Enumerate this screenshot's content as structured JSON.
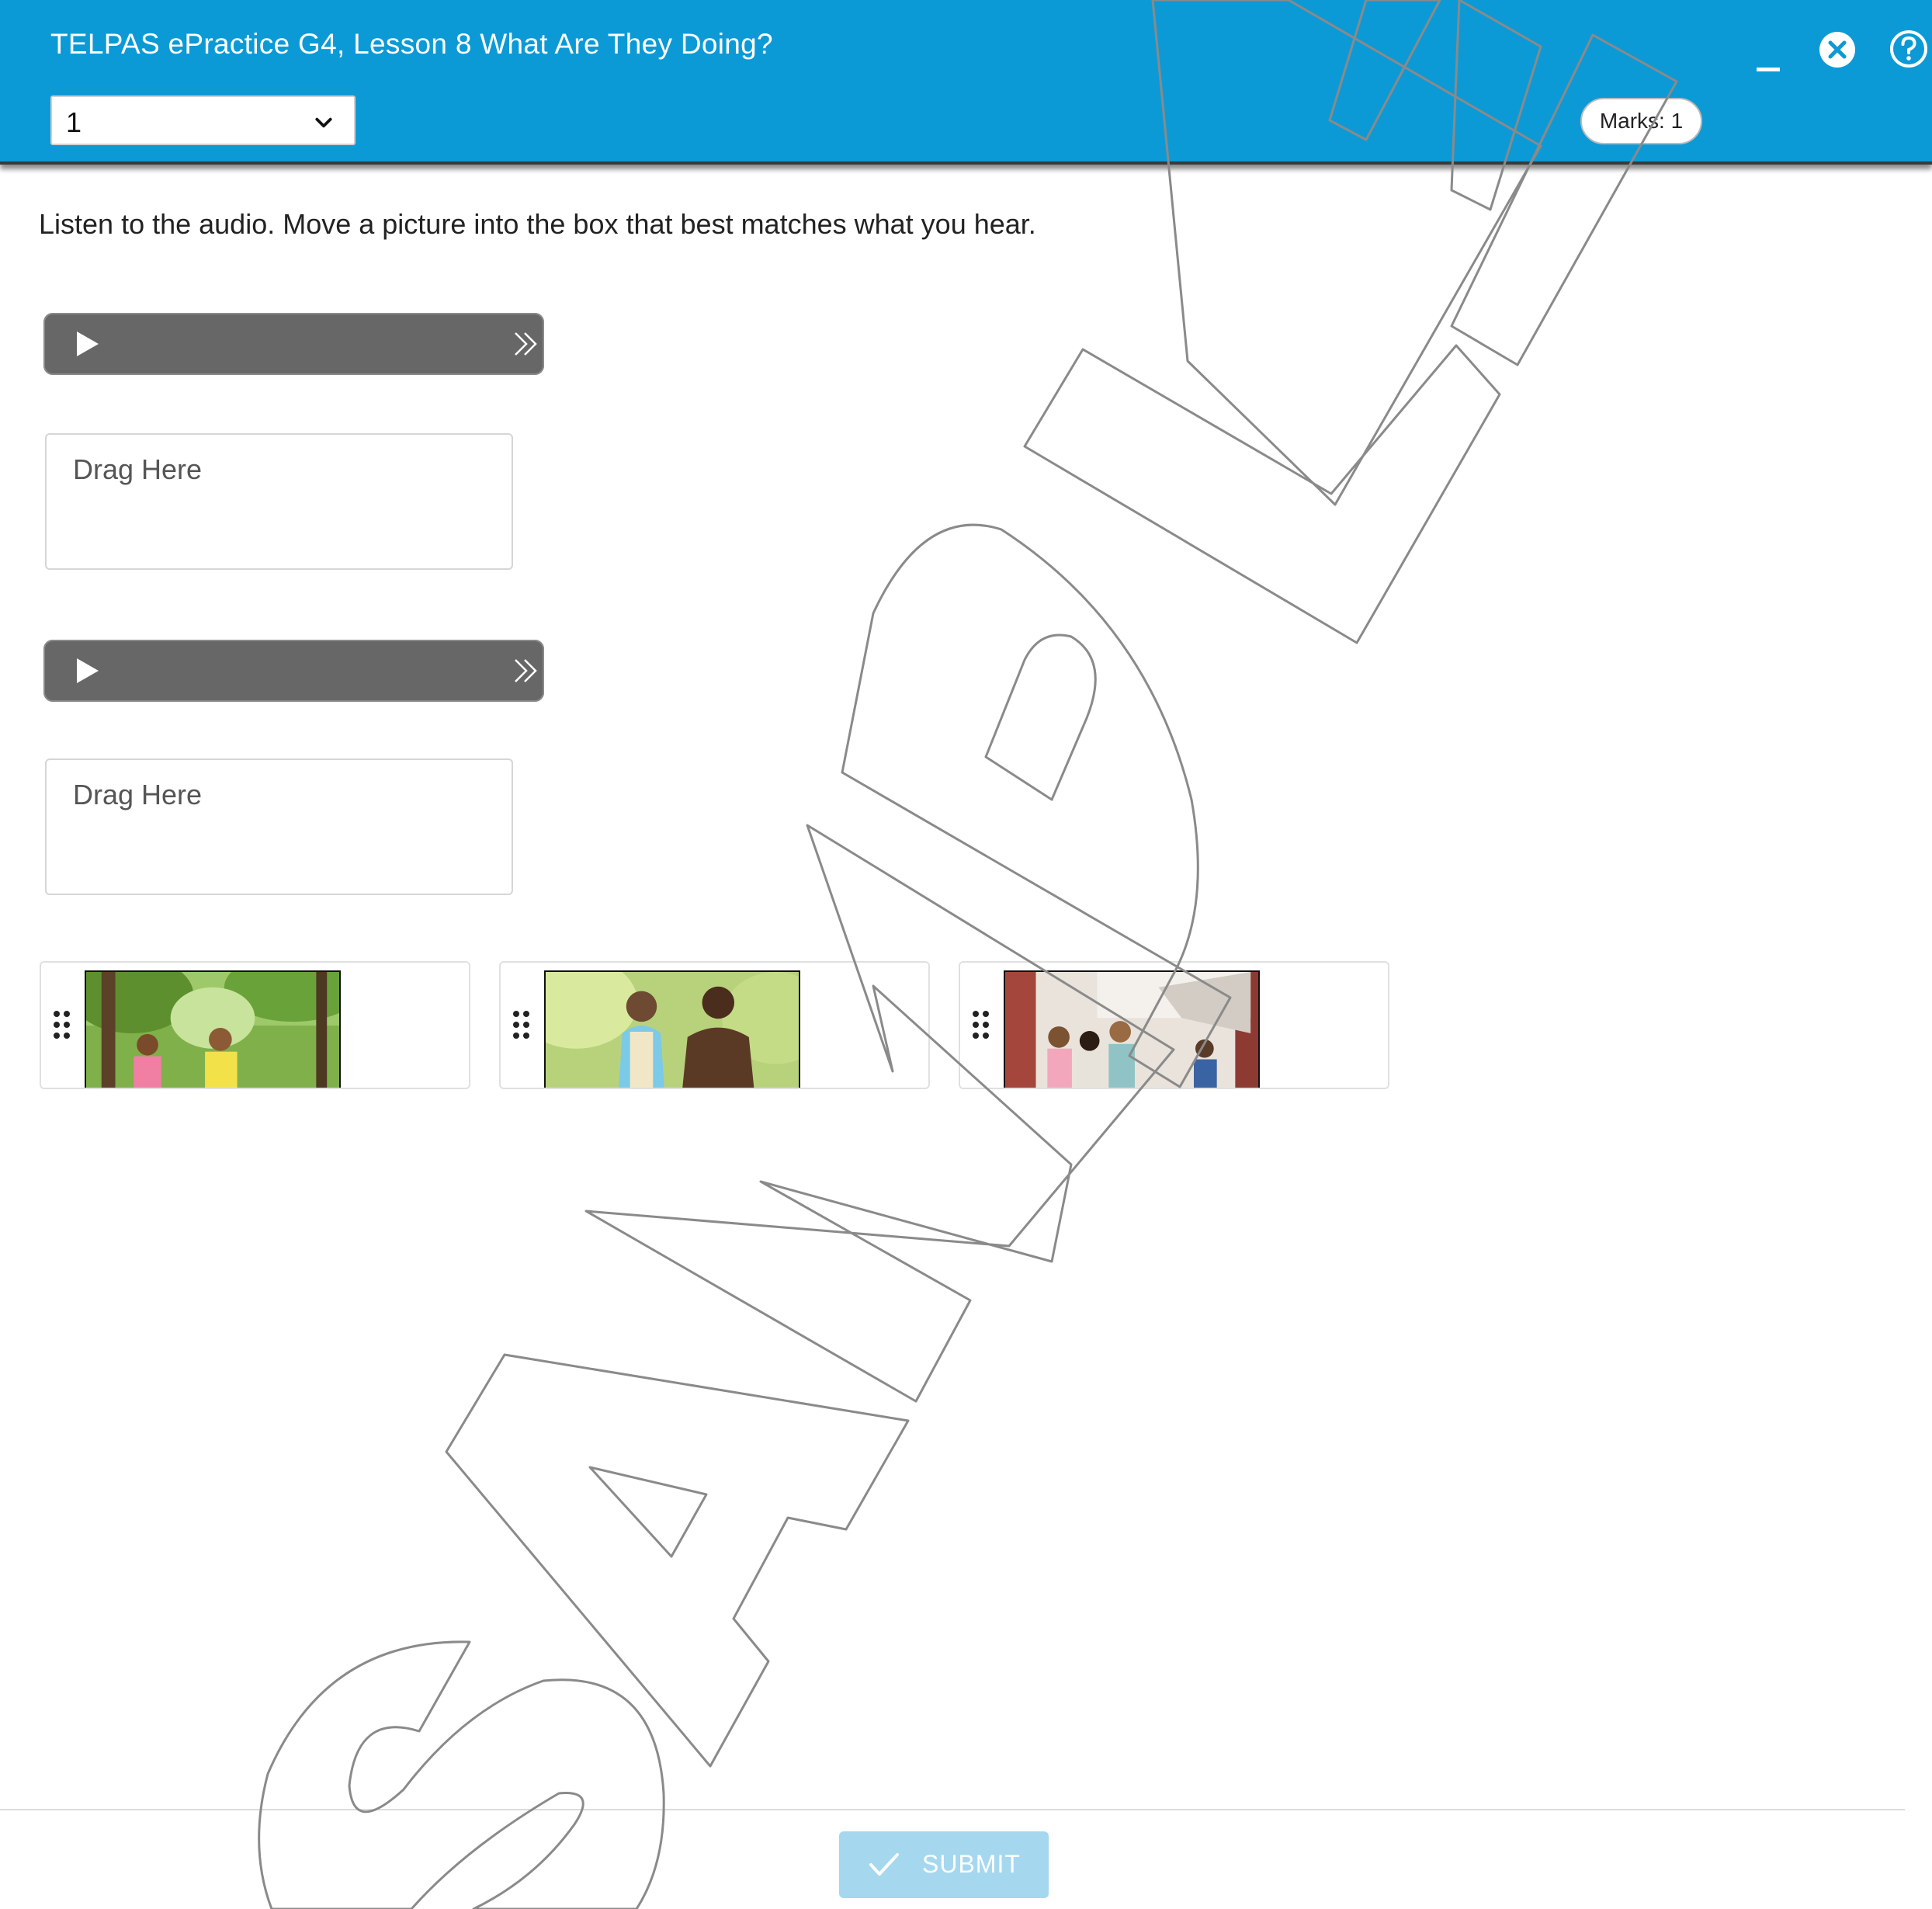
{
  "header": {
    "title": "TELPAS ePractice G4, Lesson 8 What Are They Doing?",
    "question_select_value": "1",
    "marks_label": "Marks: 1",
    "minimize_icon": "minimize-icon",
    "close_icon": "close-circle-icon",
    "help_icon": "help-circle-icon",
    "bg_color": "#0c9ad6"
  },
  "main": {
    "instruction": "Listen to the audio. Move a picture into the box that best matches what you hear.",
    "audio_players": [
      {
        "play_icon": "play-icon",
        "skip_icon": "double-chevron-right-icon"
      },
      {
        "play_icon": "play-icon",
        "skip_icon": "double-chevron-right-icon"
      }
    ],
    "drop_zones": [
      {
        "label": "Drag Here"
      },
      {
        "label": "Drag Here"
      }
    ],
    "picture_tiles": [
      {
        "description_icon": "photo-girls-in-park",
        "grip_icon": "drag-handle-icon"
      },
      {
        "description_icon": "photo-older-couple-walking",
        "grip_icon": "drag-handle-icon"
      },
      {
        "description_icon": "photo-students-in-hallway",
        "grip_icon": "drag-handle-icon"
      }
    ]
  },
  "footer": {
    "submit_label": "SUBMIT",
    "submit_icon": "checkmark-icon",
    "submit_color": "#a5d8ef"
  },
  "watermark": {
    "text": "SAMPLE"
  }
}
